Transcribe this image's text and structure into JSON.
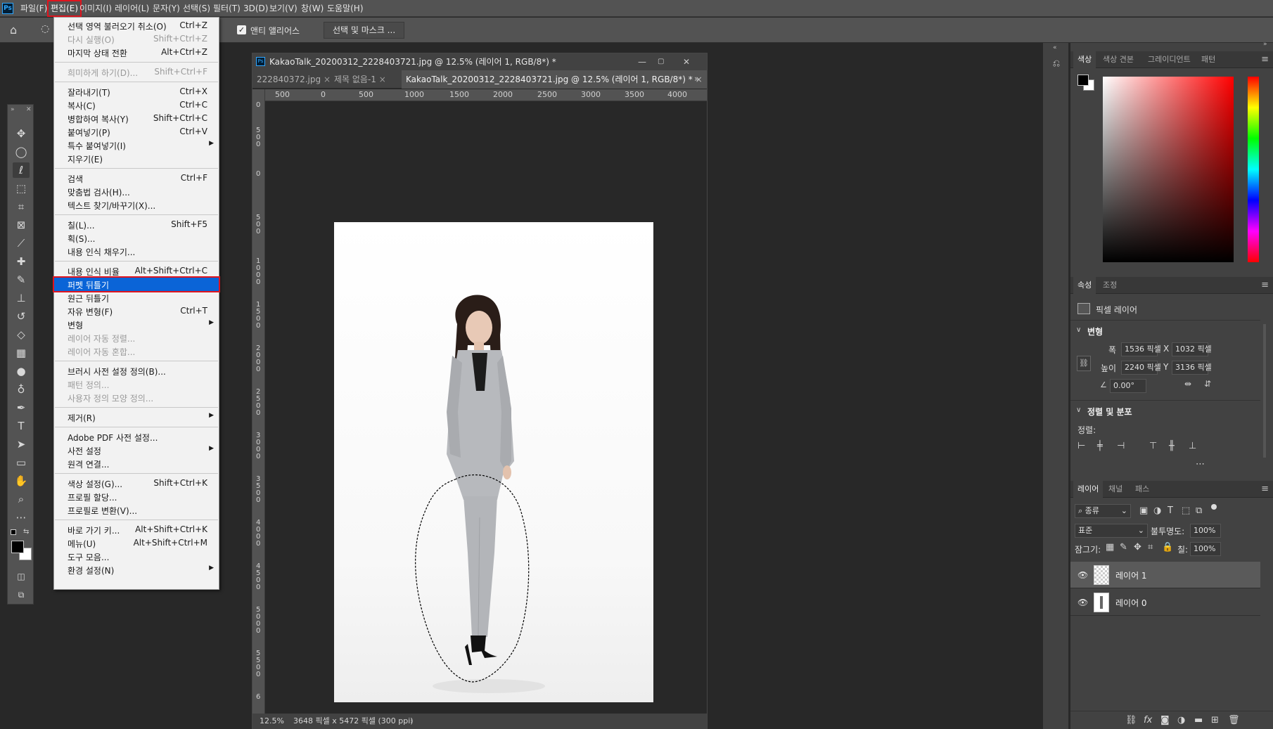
{
  "menubar": {
    "logo": "Ps",
    "items": [
      "파일(F)",
      "편집(E)",
      "이미지(I)",
      "레이어(L)",
      "문자(Y)",
      "선택(S)",
      "필터(T)",
      "3D(D)",
      "보기(V)",
      "창(W)",
      "도움말(H)"
    ]
  },
  "options": {
    "anti_alias_label": "앤티 앨리어스",
    "select_mask_label": "선택 및 마스크 ..."
  },
  "document": {
    "title": "KakaoTalk_20200312_2228403721.jpg @ 12.5% (레이어 1, RGB/8*) *",
    "tabs": [
      "222840372.jpg",
      "제목 없음-1",
      "KakaoTalk_20200312_2228403721.jpg @ 12.5% (레이어 1, RGB/8*) *"
    ],
    "ruler_h": [
      "500",
      "0",
      "500",
      "1000",
      "1500",
      "2000",
      "2500",
      "3000",
      "3500",
      "4000"
    ],
    "ruler_v": [
      "0",
      "500",
      "0",
      "500",
      "1000",
      "1500",
      "2000",
      "2500",
      "3000",
      "3500",
      "4000",
      "4500",
      "5000",
      "5500",
      "6"
    ],
    "zoom": "12.5%",
    "size_info": "3648 픽셀 x 5472 픽셀 (300 ppi)"
  },
  "edit_menu": {
    "items": [
      {
        "label": "선택 영역 불러오기 취소(O)",
        "shortcut": "Ctrl+Z",
        "disabled": false
      },
      {
        "label": "다시 실행(O)",
        "shortcut": "Shift+Ctrl+Z",
        "disabled": true
      },
      {
        "label": "마지막 상태 전환",
        "shortcut": "Alt+Ctrl+Z",
        "disabled": false
      },
      {
        "sep": true
      },
      {
        "label": "희미하게 하기(D)...",
        "shortcut": "Shift+Ctrl+F",
        "disabled": true
      },
      {
        "sep": true
      },
      {
        "label": "잘라내기(T)",
        "shortcut": "Ctrl+X",
        "disabled": false
      },
      {
        "label": "복사(C)",
        "shortcut": "Ctrl+C",
        "disabled": false
      },
      {
        "label": "병합하여 복사(Y)",
        "shortcut": "Shift+Ctrl+C",
        "disabled": false
      },
      {
        "label": "붙여넣기(P)",
        "shortcut": "Ctrl+V",
        "disabled": false
      },
      {
        "label": "특수 붙여넣기(I)",
        "shortcut": "",
        "disabled": false,
        "submenu": true
      },
      {
        "label": "지우기(E)",
        "shortcut": "",
        "disabled": false
      },
      {
        "sep": true
      },
      {
        "label": "검색",
        "shortcut": "Ctrl+F",
        "disabled": false
      },
      {
        "label": "맞춤법 검사(H)...",
        "shortcut": "",
        "disabled": false
      },
      {
        "label": "텍스트 찾기/바꾸기(X)...",
        "shortcut": "",
        "disabled": false
      },
      {
        "sep": true
      },
      {
        "label": "칠(L)...",
        "shortcut": "Shift+F5",
        "disabled": false
      },
      {
        "label": "획(S)...",
        "shortcut": "",
        "disabled": false
      },
      {
        "label": "내용 인식 채우기...",
        "shortcut": "",
        "disabled": false
      },
      {
        "sep": true
      },
      {
        "label": "내용 인식 비율",
        "shortcut": "Alt+Shift+Ctrl+C",
        "disabled": false
      },
      {
        "label": "퍼펫 뒤틀기",
        "shortcut": "",
        "disabled": false,
        "highlight": true
      },
      {
        "label": "원근 뒤틀기",
        "shortcut": "",
        "disabled": false
      },
      {
        "label": "자유 변형(F)",
        "shortcut": "Ctrl+T",
        "disabled": false
      },
      {
        "label": "변형",
        "shortcut": "",
        "disabled": false,
        "submenu": true
      },
      {
        "label": "레이어 자동 정렬...",
        "shortcut": "",
        "disabled": true
      },
      {
        "label": "레이어 자동 혼합...",
        "shortcut": "",
        "disabled": true
      },
      {
        "sep": true
      },
      {
        "label": "브러시 사전 설정 정의(B)...",
        "shortcut": "",
        "disabled": false
      },
      {
        "label": "패턴 정의...",
        "shortcut": "",
        "disabled": true
      },
      {
        "label": "사용자 정의 모양 정의...",
        "shortcut": "",
        "disabled": true
      },
      {
        "sep": true
      },
      {
        "label": "제거(R)",
        "shortcut": "",
        "disabled": false,
        "submenu": true
      },
      {
        "sep": true
      },
      {
        "label": "Adobe PDF 사전 설정...",
        "shortcut": "",
        "disabled": false
      },
      {
        "label": "사전 설정",
        "shortcut": "",
        "disabled": false,
        "submenu": true
      },
      {
        "label": "원격 연결...",
        "shortcut": "",
        "disabled": false
      },
      {
        "sep": true
      },
      {
        "label": "색상 설정(G)...",
        "shortcut": "Shift+Ctrl+K",
        "disabled": false
      },
      {
        "label": "프로필 할당...",
        "shortcut": "",
        "disabled": false
      },
      {
        "label": "프로필로 변환(V)...",
        "shortcut": "",
        "disabled": false
      },
      {
        "sep": true
      },
      {
        "label": "바로 가기 키...",
        "shortcut": "Alt+Shift+Ctrl+K",
        "disabled": false
      },
      {
        "label": "메뉴(U)",
        "shortcut": "Alt+Shift+Ctrl+M",
        "disabled": false
      },
      {
        "label": "도구 모음...",
        "shortcut": "",
        "disabled": false
      },
      {
        "label": "환경 설정(N)",
        "shortcut": "",
        "disabled": false,
        "submenu": true
      }
    ]
  },
  "color_panel": {
    "tabs": [
      "색상",
      "색상 견본",
      "그레이디언트",
      "패턴"
    ]
  },
  "properties_panel": {
    "tabs": [
      "속성",
      "조정"
    ],
    "layer_type": "픽셀 레이어",
    "transform_heading": "변형",
    "w_label": "폭",
    "w_value": "1536 픽셀",
    "h_label": "높이",
    "h_value": "2240 픽셀",
    "x_label": "X",
    "x_value": "1032 픽셀",
    "y_label": "Y",
    "y_value": "3136 픽셀",
    "angle": "0.00°",
    "align_heading": "정렬 및 분포",
    "align_label": "정렬:"
  },
  "layers_panel": {
    "tabs": [
      "레이어",
      "채널",
      "패스"
    ],
    "filter": "종류",
    "blend_mode": "표준",
    "opacity_label": "불투명도:",
    "opacity": "100%",
    "lock_label": "잠그기:",
    "fill_label": "칠:",
    "fill": "100%",
    "layers": [
      "레이어 1",
      "레이어 0"
    ]
  },
  "colors": {
    "accent": "#0a64d7",
    "highlight_border": "#e0141e"
  }
}
